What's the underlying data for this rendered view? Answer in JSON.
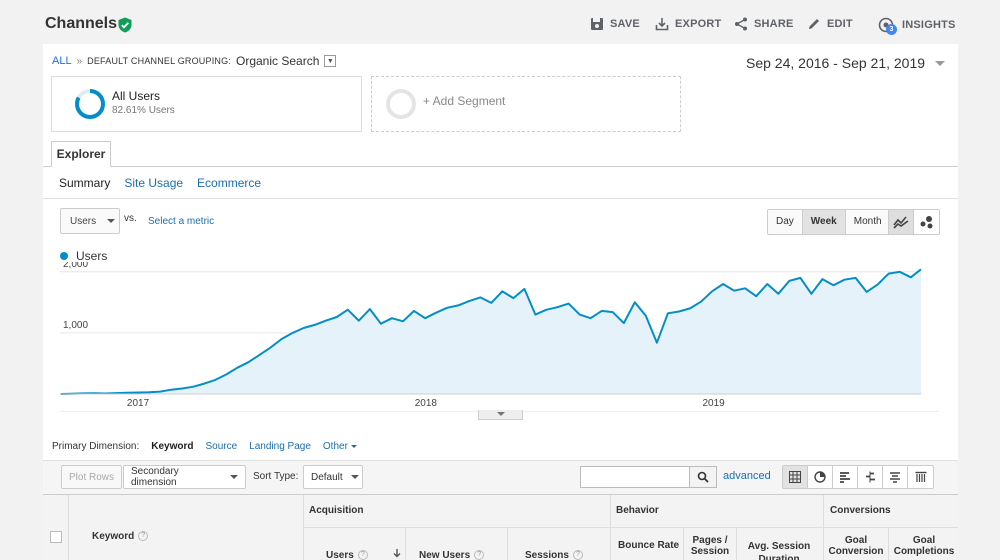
{
  "header": {
    "title": "Channels",
    "save": "SAVE",
    "export": "EXPORT",
    "share": "SHARE",
    "edit": "EDIT",
    "insights": "INSIGHTS",
    "insights_badge": "3"
  },
  "breadcrumb": {
    "all": "ALL",
    "separator": "»",
    "grouping_key": "DEFAULT CHANNEL GROUPING:",
    "grouping_value": "Organic Search"
  },
  "date_range": "Sep 24, 2016 - Sep 21, 2019",
  "segments": {
    "active_name": "All Users",
    "active_sub": "82.61% Users",
    "active_percent": 82.61,
    "add_label": "+ Add Segment"
  },
  "tabs": {
    "explorer": "Explorer"
  },
  "subtabs": [
    "Summary",
    "Site Usage",
    "Ecommerce"
  ],
  "metric_controls": {
    "metric": "Users",
    "vs": "vs.",
    "select_metric": "Select a metric",
    "periods": [
      "Day",
      "Week",
      "Month"
    ],
    "active_period": "Week"
  },
  "chart_data": {
    "type": "area",
    "series": [
      {
        "name": "Users",
        "color": "#058dc7",
        "x": [
          "2016-09-25",
          "2016-10-09",
          "2016-10-23",
          "2016-11-06",
          "2016-11-20",
          "2016-12-04",
          "2016-12-18",
          "2017-01-01",
          "2017-01-15",
          "2017-01-29",
          "2017-02-12",
          "2017-02-26",
          "2017-03-12",
          "2017-03-26",
          "2017-04-09",
          "2017-04-23",
          "2017-05-07",
          "2017-05-21",
          "2017-06-04",
          "2017-06-18",
          "2017-07-02",
          "2017-07-16",
          "2017-07-30",
          "2017-08-13",
          "2017-08-27",
          "2017-09-10",
          "2017-09-24",
          "2017-10-08",
          "2017-10-22",
          "2017-11-05",
          "2017-11-19",
          "2017-12-03",
          "2017-12-17",
          "2017-12-31",
          "2018-01-14",
          "2018-01-28",
          "2018-02-11",
          "2018-02-25",
          "2018-03-11",
          "2018-03-25",
          "2018-04-08",
          "2018-04-22",
          "2018-05-06",
          "2018-05-20",
          "2018-06-03",
          "2018-06-17",
          "2018-07-01",
          "2018-07-15",
          "2018-07-29",
          "2018-08-12",
          "2018-08-26",
          "2018-09-09",
          "2018-09-23",
          "2018-10-07",
          "2018-10-21",
          "2018-11-04",
          "2018-11-18",
          "2018-12-02",
          "2018-12-16",
          "2018-12-30",
          "2019-01-13",
          "2019-01-27",
          "2019-02-10",
          "2019-02-24",
          "2019-03-10",
          "2019-03-24",
          "2019-04-07",
          "2019-04-21",
          "2019-05-05",
          "2019-05-19",
          "2019-06-02",
          "2019-06-16",
          "2019-06-30",
          "2019-07-14",
          "2019-07-28",
          "2019-08-11",
          "2019-08-25",
          "2019-09-08",
          "2019-09-21"
        ],
        "values": [
          0,
          5,
          10,
          12,
          8,
          15,
          20,
          25,
          30,
          40,
          70,
          90,
          120,
          170,
          230,
          320,
          430,
          520,
          640,
          760,
          900,
          1000,
          1080,
          1130,
          1200,
          1260,
          1380,
          1200,
          1390,
          1150,
          1240,
          1190,
          1360,
          1240,
          1330,
          1410,
          1450,
          1520,
          1580,
          1490,
          1680,
          1570,
          1720,
          1300,
          1380,
          1420,
          1480,
          1300,
          1240,
          1360,
          1340,
          1160,
          1500,
          1280,
          840,
          1320,
          1350,
          1400,
          1510,
          1680,
          1800,
          1690,
          1730,
          1600,
          1800,
          1640,
          1850,
          1900,
          1640,
          1880,
          1780,
          1870,
          1900,
          1670,
          1790,
          1970,
          2000,
          1910,
          2040
        ]
      }
    ],
    "ylim": [
      0,
      2160
    ],
    "yticks": [
      {
        "value": 1000,
        "label": "1,000"
      },
      {
        "value": 2000,
        "label": "2,000"
      }
    ],
    "xticks": [
      {
        "value": "2017-01-01",
        "label": "2017"
      },
      {
        "value": "2018-01-01",
        "label": "2018"
      },
      {
        "value": "2019-01-01",
        "label": "2019"
      }
    ],
    "xlim": [
      "2016-09-24",
      "2019-09-21"
    ],
    "grid": true,
    "legend_position": "top-left"
  },
  "primary_dimension": {
    "label": "Primary Dimension:",
    "active": "Keyword",
    "options": [
      "Source",
      "Landing Page"
    ],
    "other": "Other"
  },
  "table_toolbar": {
    "plot_rows": "Plot Rows",
    "secondary_dimension": "Secondary dimension",
    "sort_type_label": "Sort Type:",
    "sort_type_value": "Default",
    "search_value": "",
    "advanced": "advanced"
  },
  "table_header": {
    "keyword": "Keyword",
    "groups": [
      "Acquisition",
      "Behavior",
      "Conversions"
    ],
    "columns": [
      "Users",
      "New Users",
      "Sessions",
      "Bounce Rate",
      "Pages /\nSession",
      "Avg. Session\nDuration",
      "Goal\nConversion",
      "Goal\nCompletions"
    ],
    "help": "?"
  }
}
